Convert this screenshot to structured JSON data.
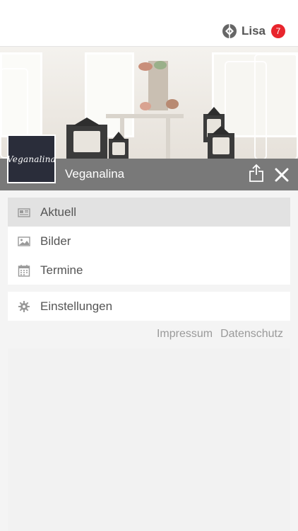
{
  "header": {
    "user_name": "Lisa",
    "notification_count": "7",
    "icons": {
      "user": "network-logo-icon"
    }
  },
  "hero": {
    "image": "cafe-interior-photo",
    "logo_text": "Veganalina",
    "title": "Veganalina",
    "icons": {
      "share": "share-icon",
      "close": "close-icon"
    }
  },
  "menu": {
    "items": [
      {
        "label": "Aktuell",
        "icon": "newspaper-icon",
        "active": true
      },
      {
        "label": "Bilder",
        "icon": "image-icon",
        "active": false
      },
      {
        "label": "Termine",
        "icon": "calendar-icon",
        "active": false
      }
    ],
    "settings": {
      "label": "Einstellungen",
      "icon": "gear-icon"
    }
  },
  "footer_links": {
    "impressum": "Impressum",
    "datenschutz": "Datenschutz"
  },
  "colors": {
    "badge": "#e8252d",
    "titlebar": "#6e6e6e",
    "logo_bg": "#2a2d3a",
    "active_item": "#e2e2e2"
  }
}
